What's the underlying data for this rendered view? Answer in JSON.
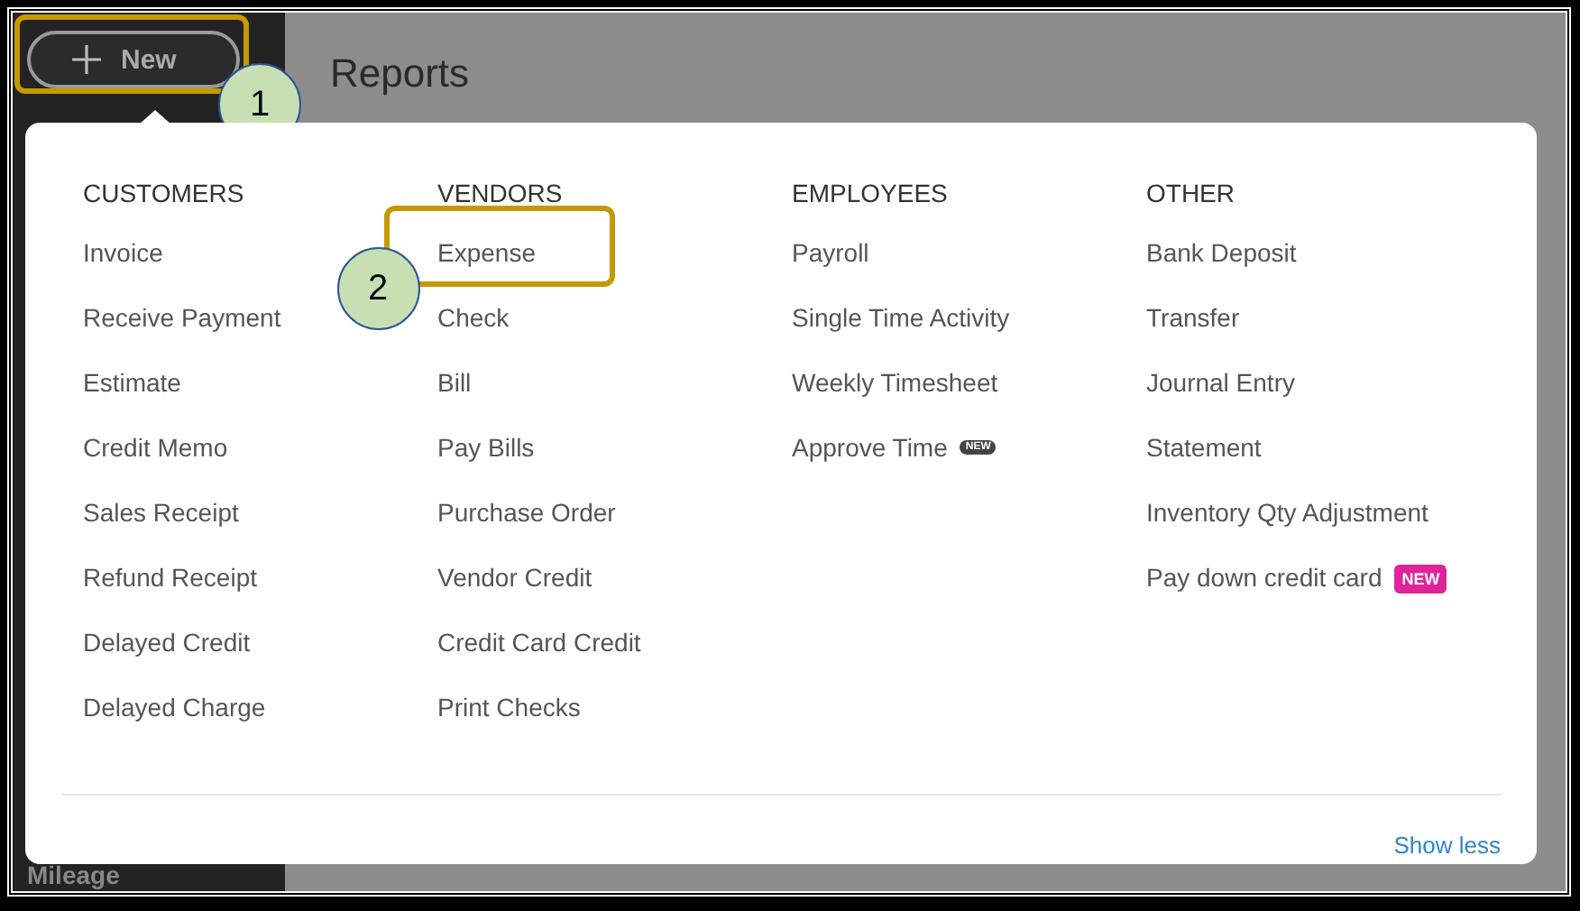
{
  "new_button": {
    "label": "New",
    "callout": "1"
  },
  "page_title": "Reports",
  "sidebar": {
    "items": [
      {
        "label": "Mileage"
      }
    ]
  },
  "menu": {
    "columns": [
      {
        "heading": "CUSTOMERS",
        "items": [
          {
            "label": "Invoice"
          },
          {
            "label": "Receive Payment"
          },
          {
            "label": "Estimate"
          },
          {
            "label": "Credit Memo"
          },
          {
            "label": "Sales Receipt"
          },
          {
            "label": "Refund Receipt"
          },
          {
            "label": "Delayed Credit"
          },
          {
            "label": "Delayed Charge"
          }
        ]
      },
      {
        "heading": "VENDORS",
        "items": [
          {
            "label": "Expense",
            "callout": "2"
          },
          {
            "label": "Check"
          },
          {
            "label": "Bill"
          },
          {
            "label": "Pay Bills"
          },
          {
            "label": "Purchase Order"
          },
          {
            "label": "Vendor Credit"
          },
          {
            "label": "Credit Card Credit"
          },
          {
            "label": "Print Checks"
          }
        ]
      },
      {
        "heading": "EMPLOYEES",
        "items": [
          {
            "label": "Payroll"
          },
          {
            "label": "Single Time Activity"
          },
          {
            "label": "Weekly Timesheet"
          },
          {
            "label": "Approve Time",
            "badge": {
              "label": "NEW",
              "kind": "small"
            }
          }
        ]
      },
      {
        "heading": "OTHER",
        "items": [
          {
            "label": "Bank Deposit"
          },
          {
            "label": "Transfer"
          },
          {
            "label": "Journal Entry"
          },
          {
            "label": "Statement"
          },
          {
            "label": "Inventory Qty Adjustment"
          },
          {
            "label": "Pay down credit card",
            "badge": {
              "label": "NEW",
              "kind": "large"
            }
          }
        ]
      }
    ],
    "show_less": "Show less"
  }
}
